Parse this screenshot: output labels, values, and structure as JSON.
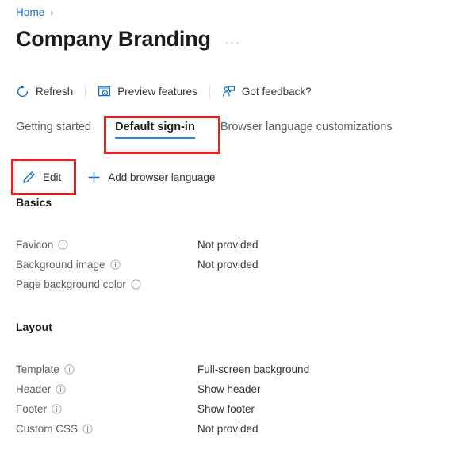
{
  "breadcrumb": {
    "items": [
      {
        "label": "Home",
        "icon": "home-link"
      }
    ],
    "separator": "›"
  },
  "header": {
    "title": "Company Branding",
    "more_actions": "···",
    "more_actions_name": "more-actions-ellipsis"
  },
  "command_bar": {
    "commands": [
      {
        "label": "Refresh",
        "icon": "refresh-icon"
      },
      {
        "label": "Preview features",
        "icon": "preview-features-icon"
      },
      {
        "label": "Got feedback?",
        "icon": "feedback-icon"
      }
    ]
  },
  "tabs": [
    {
      "label": "Getting started",
      "selected": false
    },
    {
      "label": "Default sign-in",
      "selected": true
    },
    {
      "label": "Browser language customizations",
      "selected": false
    }
  ],
  "action_bar": {
    "actions": [
      {
        "label": "Edit",
        "icon": "pencil-icon"
      },
      {
        "label": "Add browser language",
        "icon": "plus-icon"
      }
    ]
  },
  "sections": [
    {
      "heading": "Basics",
      "rows": [
        {
          "label": "Favicon",
          "info": "info-icon",
          "value": "Not provided"
        },
        {
          "label": "Background image",
          "info": "info-icon",
          "value": "Not provided"
        },
        {
          "label": "Page background color",
          "info": "info-icon",
          "value": ""
        }
      ]
    },
    {
      "heading": "Layout",
      "rows": [
        {
          "label": "Template",
          "info": "info-icon",
          "value": "Full-screen background"
        },
        {
          "label": "Header",
          "info": "info-icon",
          "value": "Show header"
        },
        {
          "label": "Footer",
          "info": "info-icon",
          "value": "Show footer"
        },
        {
          "label": "Custom CSS",
          "info": "info-icon",
          "value": "Not provided"
        }
      ]
    }
  ],
  "annotations": [
    {
      "name": "highlight-default-signin-tab",
      "color": "#ee1c25"
    },
    {
      "name": "highlight-edit-button",
      "color": "#ee1c25"
    }
  ],
  "colors": {
    "link": "#0f6cbd",
    "accent": "#2b88d8",
    "icon_blue": "#0f6cbd",
    "annotation_red": "#ee1c25",
    "text_primary": "#1b1a19",
    "text_secondary": "#605e5c"
  }
}
